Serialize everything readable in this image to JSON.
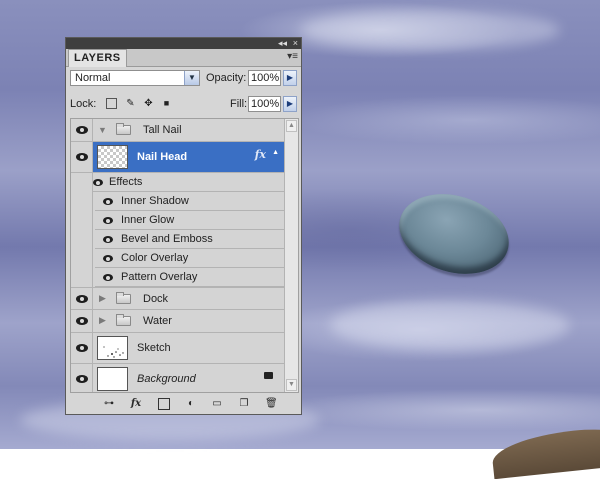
{
  "panel": {
    "tab_label": "LAYERS",
    "collapse_label": "◂◂",
    "close_label": "×",
    "menu_label": "▾≡"
  },
  "blend": {
    "mode": "Normal",
    "opacity_label": "Opacity:",
    "opacity_value": "100%",
    "lock_label": "Lock:",
    "fill_label": "Fill:",
    "fill_value": "100%"
  },
  "layers": {
    "tall_nail": "Tall Nail",
    "nail_head": "Nail Head",
    "fx": "fx",
    "effects_label": "Effects",
    "effects": [
      "Inner Shadow",
      "Inner Glow",
      "Bevel and Emboss",
      "Color Overlay",
      "Pattern Overlay"
    ],
    "dock": "Dock",
    "water": "Water",
    "sketch": "Sketch",
    "background": "Background"
  },
  "icons": {
    "link": "⊶",
    "fx": "fx",
    "mask": "◙",
    "adjust": "◐",
    "folder": "▭",
    "new": "❐",
    "trash": "🗑",
    "lock": "🔒",
    "move": "✥",
    "brush": "✎",
    "transparency": "▦"
  }
}
